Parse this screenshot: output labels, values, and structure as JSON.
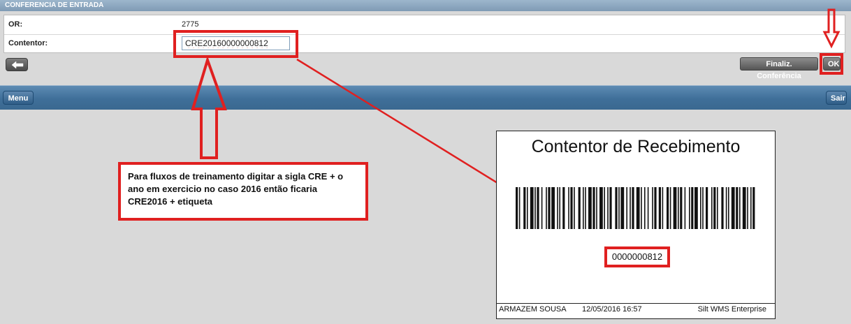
{
  "header": {
    "title": "CONFERENCIA DE ENTRADA"
  },
  "form": {
    "or_label": "OR:",
    "or_value": "2775",
    "contentor_label": "Contentor:",
    "contentor_value": "CRE20160000000812"
  },
  "toolbar": {
    "back_icon": "arrow-left-icon",
    "finalize_label": "Finaliz. Conferência",
    "ok_label": "OK"
  },
  "nav": {
    "menu_label": "Menu",
    "exit_label": "Sair"
  },
  "annotation": {
    "text": "Para fluxos de treinamento digitar a sigla CRE + o ano em exercicio no caso 2016 então ficaria CRE2016 + etiqueta",
    "color": "#e02020"
  },
  "label_card": {
    "title": "Contentor de Recebimento",
    "barcode_number": "0000000812",
    "footer_left": "ARMAZEM SOUSA",
    "footer_mid": "12/05/2016 16:57",
    "footer_right": "Silt WMS Enterprise"
  },
  "colors": {
    "top_bar": "#8aa6c0",
    "nav_bar": "#3f6f99",
    "annotation_red": "#e02020",
    "background": "#d9d9d9"
  }
}
